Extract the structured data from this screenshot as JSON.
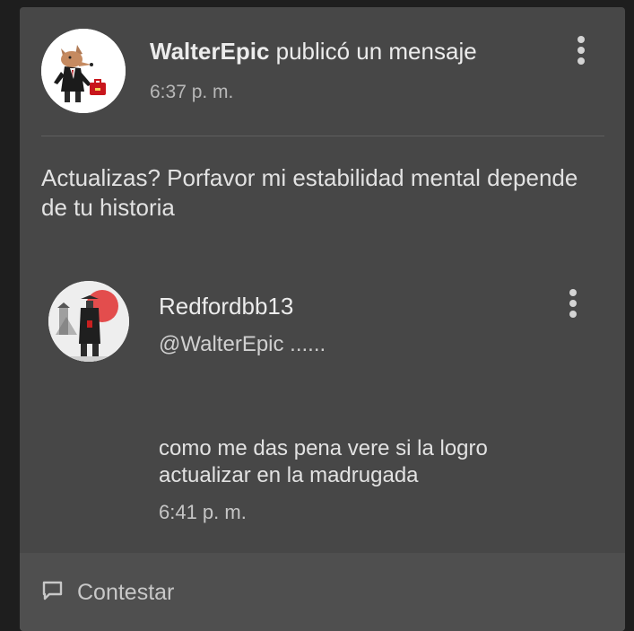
{
  "post": {
    "author": "WalterEpic",
    "action": "publicó un mensaje",
    "time": "6:37 p. m.",
    "text": "Actualizas? Porfavor mi estabilidad mental depende de tu historia"
  },
  "reply": {
    "author": "Redfordbb13",
    "mention": "@WalterEpic ......",
    "text": "como me das pena vere si la logro actualizar en la madrugada",
    "time": "6:41 p. m."
  },
  "footer": {
    "reply_label": "Contestar"
  },
  "icons": {
    "post_menu": "more-vertical-icon",
    "reply_menu": "more-vertical-icon",
    "reply_action": "comment-icon"
  },
  "colors": {
    "card_bg": "#474747",
    "page_bg": "#1e1e1e",
    "footer_bg": "#4f4f4f"
  }
}
